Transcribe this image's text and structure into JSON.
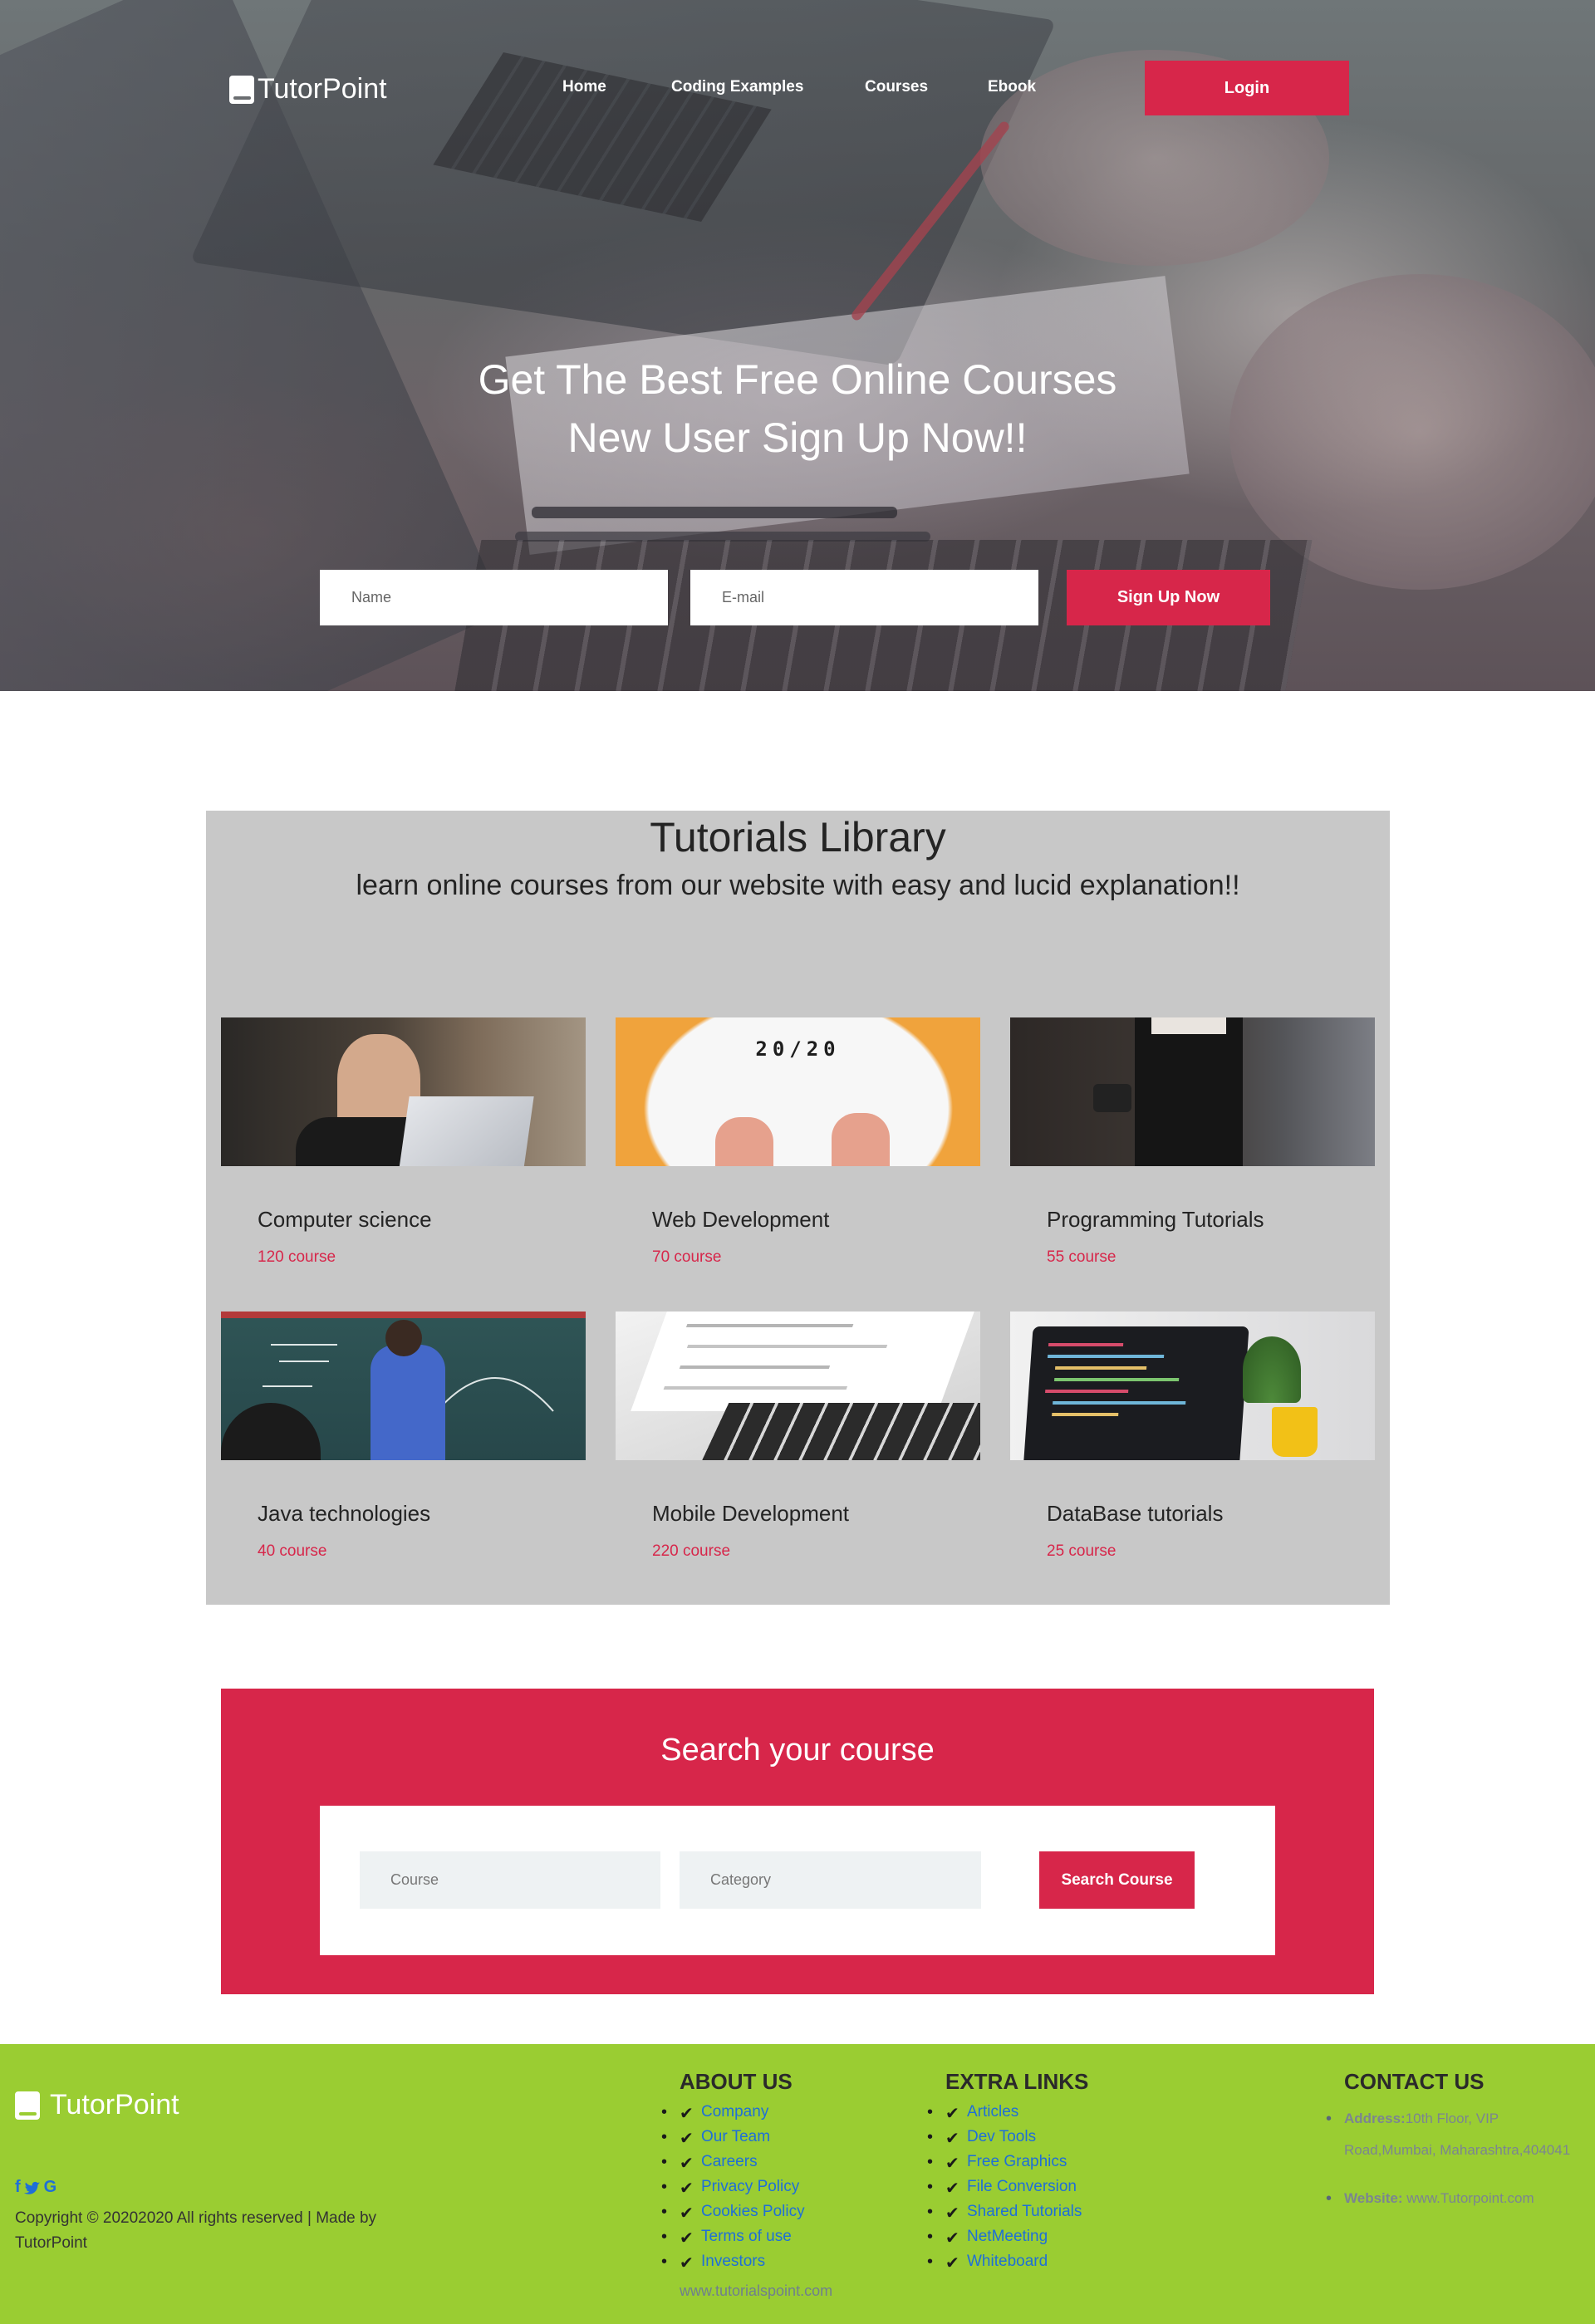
{
  "brand": {
    "name": "TutorPoint"
  },
  "nav": {
    "items": [
      "Home",
      "Coding Examples",
      "Courses",
      "Ebook"
    ],
    "login_label": "Login"
  },
  "hero": {
    "title_line1": "Get The Best Free Online Courses",
    "title_line2": "New User Sign Up Now!!",
    "name_placeholder": "Name",
    "email_placeholder": "E-mail",
    "signup_label": "Sign Up Now"
  },
  "library": {
    "title": "Tutorials Library",
    "subtitle": "learn online courses from our website with easy and lucid explanation!!",
    "courses": [
      {
        "title": "Computer science",
        "count": "120 course"
      },
      {
        "title": "Web Development",
        "count": "70 course"
      },
      {
        "title": "Programming Tutorials",
        "count": "55 course"
      },
      {
        "title": "Java technologies",
        "count": "40 course"
      },
      {
        "title": "Mobile Development",
        "count": "220 course"
      },
      {
        "title": "DataBase tutorials",
        "count": "25 course"
      }
    ],
    "web_image_text": "20/20"
  },
  "search": {
    "title": "Search your course",
    "course_placeholder": "Course",
    "category_placeholder": "Category",
    "button_label": "Search Course"
  },
  "footer": {
    "social": [
      "f",
      "t",
      "G"
    ],
    "copyright": "Copyright © 20202020 All rights reserved | Made by TutorPoint",
    "about": {
      "heading": "ABOUT US",
      "links": [
        "Company",
        "Our Team",
        "Careers",
        "Privacy Policy",
        "Cookies Policy",
        "Terms of use",
        "Investors"
      ],
      "site": "www.tutorialspoint.com"
    },
    "extra": {
      "heading": "EXTRA LINKS",
      "links": [
        "Articles",
        "Dev Tools",
        "Free Graphics",
        "File Conversion",
        "Shared Tutorials",
        "NetMeeting",
        "Whiteboard"
      ]
    },
    "contact": {
      "heading": "CONTACT US",
      "address_label": "Address:",
      "address": "10th Floor, VIP Road,Mumbai, Maharashtra,404041",
      "website_label": "Website:",
      "website": "www.Tutorpoint.com"
    }
  },
  "colors": {
    "accent": "#d7264a",
    "footer_bg": "#9acd32",
    "library_bg": "#c8c8c8",
    "link": "#1e6fd8"
  }
}
